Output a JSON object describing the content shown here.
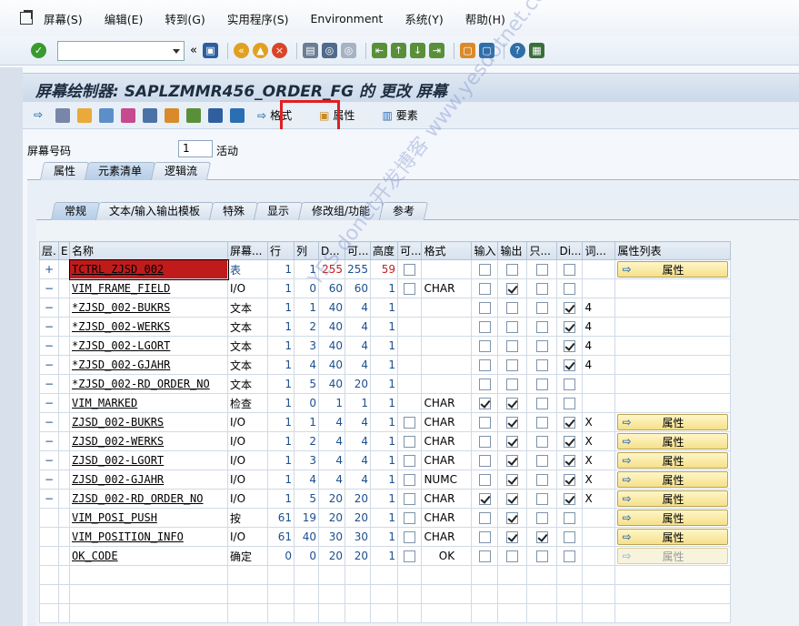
{
  "menu": [
    "屏幕(S)",
    "编辑(E)",
    "转到(G)",
    "实用程序(S)",
    "Environment",
    "系统(Y)",
    "帮助(H)"
  ],
  "title": "屏幕绘制器: SAPLZMMR456_ORDER_FG 的 更改 屏幕",
  "apptoolbar": {
    "format": "格式",
    "attributes": "属性",
    "elements": "要素"
  },
  "screen_no_label": "屏幕号码",
  "screen_no": "1",
  "status": "活动",
  "tabs_main": [
    "属性",
    "元素清单",
    "逻辑流"
  ],
  "tabs_sub": [
    "常规",
    "文本/输入输出模板",
    "特殊",
    "显示",
    "修改组/功能",
    "参考"
  ],
  "columns": [
    "层.",
    "E",
    "名称",
    "屏幕...",
    "行",
    "列",
    "D...",
    "可...",
    "高度",
    "可...",
    "格式",
    "输入",
    "输出",
    "只...",
    "Di...",
    "词...",
    "属性列表"
  ],
  "rows": [
    {
      "lvl": "+",
      "name": "TCTRL_ZJSD_002",
      "type": "表",
      "row": "1",
      "col": "1",
      "d": "255",
      "v": "255",
      "h": "59",
      "fmt": "",
      "inp": 0,
      "out": 0,
      "ro": 0,
      "di": 0,
      "w": "",
      "btn": "属性",
      "btndim": false,
      "selected": true
    },
    {
      "lvl": "−",
      "name": "VIM_FRAME_FIELD",
      "type": "I/O",
      "row": "1",
      "col": "0",
      "d": "60",
      "v": "60",
      "h": "1",
      "fmt": "CHAR",
      "inp": 0,
      "out": 1,
      "ro": 0,
      "di": 0,
      "w": "",
      "btn": "",
      "btndim": false
    },
    {
      "lvl": "−",
      "name": "*ZJSD_002-BUKRS",
      "type": "文本",
      "row": "1",
      "col": "1",
      "d": "40",
      "v": "4",
      "h": "1",
      "fmt": "",
      "inp": 0,
      "out": 0,
      "ro": 0,
      "di": 1,
      "w": "4",
      "btn": "",
      "btndim": false
    },
    {
      "lvl": "−",
      "name": "*ZJSD_002-WERKS",
      "type": "文本",
      "row": "1",
      "col": "2",
      "d": "40",
      "v": "4",
      "h": "1",
      "fmt": "",
      "inp": 0,
      "out": 0,
      "ro": 0,
      "di": 1,
      "w": "4",
      "btn": "",
      "btndim": false
    },
    {
      "lvl": "−",
      "name": "*ZJSD_002-LGORT",
      "type": "文本",
      "row": "1",
      "col": "3",
      "d": "40",
      "v": "4",
      "h": "1",
      "fmt": "",
      "inp": 0,
      "out": 0,
      "ro": 0,
      "di": 1,
      "w": "4",
      "btn": "",
      "btndim": false
    },
    {
      "lvl": "−",
      "name": "*ZJSD_002-GJAHR",
      "type": "文本",
      "row": "1",
      "col": "4",
      "d": "40",
      "v": "4",
      "h": "1",
      "fmt": "",
      "inp": 0,
      "out": 0,
      "ro": 0,
      "di": 1,
      "w": "4",
      "btn": "",
      "btndim": false
    },
    {
      "lvl": "−",
      "name": "*ZJSD_002-RD_ORDER_NO",
      "type": "文本",
      "row": "1",
      "col": "5",
      "d": "40",
      "v": "20",
      "h": "1",
      "fmt": "",
      "inp": 0,
      "out": 0,
      "ro": 0,
      "di": 0,
      "w": "",
      "btn": "",
      "btndim": false
    },
    {
      "lvl": "−",
      "name": "VIM_MARKED",
      "type": "检查",
      "row": "1",
      "col": "0",
      "d": "1",
      "v": "1",
      "h": "1",
      "fmt": "CHAR",
      "inp": 1,
      "out": 1,
      "ro": 0,
      "di": 0,
      "w": "",
      "btn": "",
      "btndim": false
    },
    {
      "lvl": "−",
      "name": "ZJSD_002-BUKRS",
      "type": "I/O",
      "row": "1",
      "col": "1",
      "d": "4",
      "v": "4",
      "h": "1",
      "fmt": "CHAR",
      "inp": 0,
      "out": 1,
      "ro": 0,
      "di": 1,
      "w": "X",
      "btn": "属性",
      "btndim": false
    },
    {
      "lvl": "−",
      "name": "ZJSD_002-WERKS",
      "type": "I/O",
      "row": "1",
      "col": "2",
      "d": "4",
      "v": "4",
      "h": "1",
      "fmt": "CHAR",
      "inp": 0,
      "out": 1,
      "ro": 0,
      "di": 1,
      "w": "X",
      "btn": "属性",
      "btndim": false
    },
    {
      "lvl": "−",
      "name": "ZJSD_002-LGORT",
      "type": "I/O",
      "row": "1",
      "col": "3",
      "d": "4",
      "v": "4",
      "h": "1",
      "fmt": "CHAR",
      "inp": 0,
      "out": 1,
      "ro": 0,
      "di": 1,
      "w": "X",
      "btn": "属性",
      "btndim": false
    },
    {
      "lvl": "−",
      "name": "ZJSD_002-GJAHR",
      "type": "I/O",
      "row": "1",
      "col": "4",
      "d": "4",
      "v": "4",
      "h": "1",
      "fmt": "NUMC",
      "inp": 0,
      "out": 1,
      "ro": 0,
      "di": 1,
      "w": "X",
      "btn": "属性",
      "btndim": false
    },
    {
      "lvl": "−",
      "name": "ZJSD_002-RD_ORDER_NO",
      "type": "I/O",
      "row": "1",
      "col": "5",
      "d": "20",
      "v": "20",
      "h": "1",
      "fmt": "CHAR",
      "inp": 1,
      "out": 1,
      "ro": 0,
      "di": 1,
      "w": "X",
      "btn": "属性",
      "btndim": false
    },
    {
      "lvl": "",
      "name": "VIM_POSI_PUSH",
      "type": "按",
      "row": "61",
      "col": "19",
      "d": "20",
      "v": "20",
      "h": "1",
      "fmt": "CHAR",
      "inp": 0,
      "out": 1,
      "ro": 0,
      "di": 0,
      "w": "",
      "btn": "属性",
      "btndim": false
    },
    {
      "lvl": "",
      "name": "VIM_POSITION_INFO",
      "type": "I/O",
      "row": "61",
      "col": "40",
      "d": "30",
      "v": "30",
      "h": "1",
      "fmt": "CHAR",
      "inp": 0,
      "out": 1,
      "ro": 1,
      "di": 0,
      "w": "",
      "btn": "属性",
      "btndim": false
    },
    {
      "lvl": "",
      "name": "OK_CODE",
      "type": "确定",
      "row": "0",
      "col": "0",
      "d": "20",
      "v": "20",
      "h": "1",
      "fmt": "OK",
      "inp": 0,
      "out": 0,
      "ro": 0,
      "di": 0,
      "w": "",
      "btn": "属性",
      "btndim": true
    }
  ],
  "watermark": "YES donet开发博客 www.yesdotnet.com"
}
